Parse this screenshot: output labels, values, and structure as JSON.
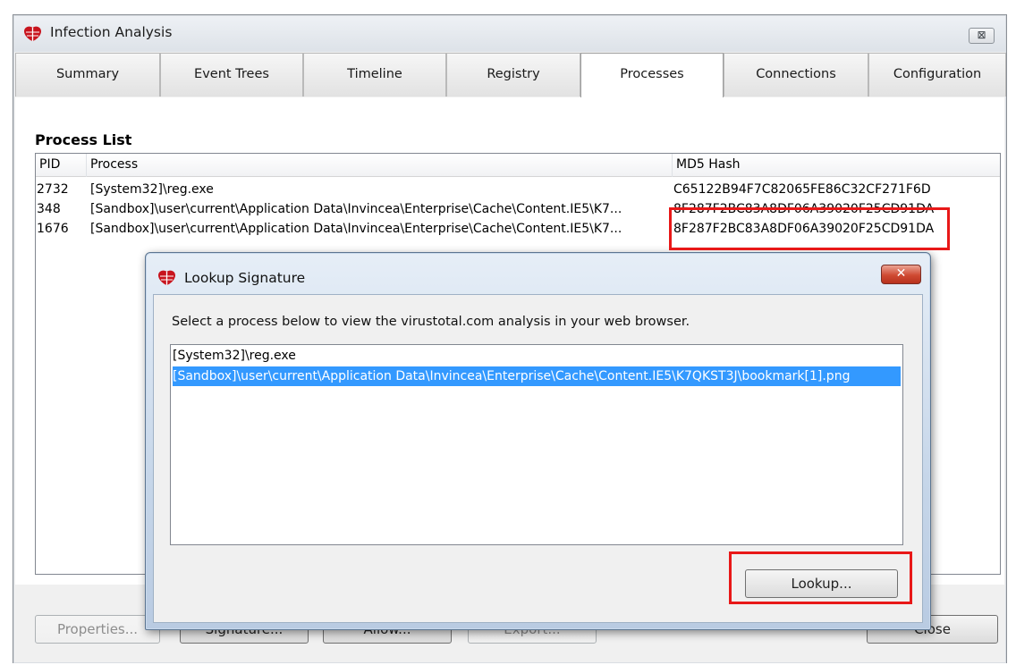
{
  "window": {
    "title": "Infection Analysis",
    "close_label": "⊠"
  },
  "tabs": [
    {
      "label": "Summary",
      "active": false
    },
    {
      "label": "Event Trees",
      "active": false
    },
    {
      "label": "Timeline",
      "active": false
    },
    {
      "label": "Registry",
      "active": false
    },
    {
      "label": "Processes",
      "active": true
    },
    {
      "label": "Connections",
      "active": false
    },
    {
      "label": "Configuration",
      "active": false
    }
  ],
  "process_list": {
    "title": "Process List",
    "columns": {
      "pid": "PID",
      "process": "Process",
      "md5": "MD5 Hash"
    },
    "rows": [
      {
        "pid": "2732",
        "process": "[System32]\\reg.exe",
        "md5": "C65122B94F7C82065FE86C32CF271F6D"
      },
      {
        "pid": "348",
        "process": "[Sandbox]\\user\\current\\Application Data\\Invincea\\Enterprise\\Cache\\Content.IE5\\K7...",
        "md5": "8F287F2BC83A8DF06A39020F25CD91DA"
      },
      {
        "pid": "1676",
        "process": "[Sandbox]\\user\\current\\Application Data\\Invincea\\Enterprise\\Cache\\Content.IE5\\K7...",
        "md5": "8F287F2BC83A8DF06A39020F25CD91DA"
      }
    ]
  },
  "buttons": {
    "properties": "Properties...",
    "signature": "Signature...",
    "allow": "Allow...",
    "export": "Export...",
    "close": "Close"
  },
  "dialog": {
    "title": "Lookup Signature",
    "close_label": "✕",
    "instruction": "Select a process below to view the virustotal.com analysis in your web browser.",
    "items": [
      {
        "label": "[System32]\\reg.exe",
        "selected": false
      },
      {
        "label": "[Sandbox]\\user\\current\\Application Data\\Invincea\\Enterprise\\Cache\\Content.IE5\\K7QKST3J\\bookmark[1].png",
        "selected": true
      }
    ],
    "lookup_label": "Lookup..."
  },
  "colors": {
    "highlight_box": "#e81818",
    "selection": "#3399ff",
    "dialog_close": "#cf4a32"
  }
}
